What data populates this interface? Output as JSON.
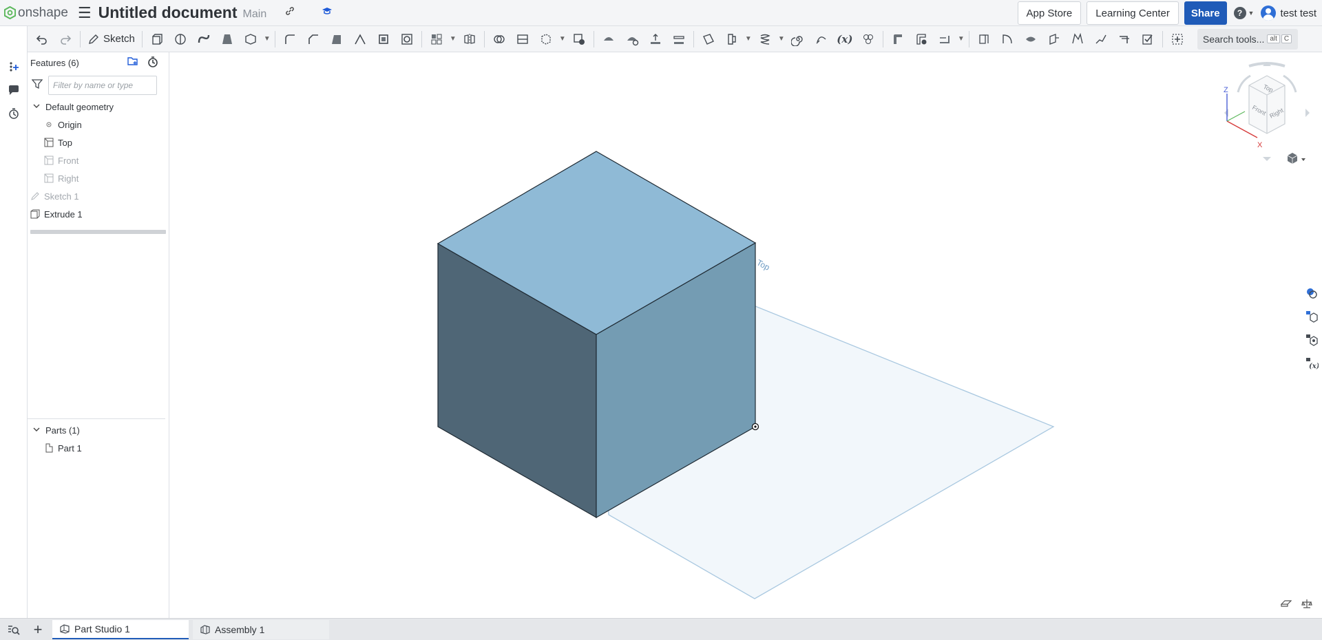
{
  "app": {
    "logo_text": "onshape",
    "document_title": "Untitled document",
    "branch": "Main"
  },
  "topbar": {
    "app_store_label": "App Store",
    "learning_center_label": "Learning Center",
    "share_label": "Share",
    "help_label": "?",
    "username": "test test"
  },
  "toolbar": {
    "sketch_label": "Sketch",
    "search_label": "Search tools...",
    "search_shortcut_alt": "alt",
    "search_shortcut_key": "C"
  },
  "features_panel": {
    "title": "Features (6)",
    "filter_placeholder": "Filter by name or type",
    "default_geometry_label": "Default geometry",
    "items": [
      {
        "label": "Origin"
      },
      {
        "label": "Top"
      },
      {
        "label": "Front"
      },
      {
        "label": "Right"
      },
      {
        "label": "Sketch 1"
      },
      {
        "label": "Extrude 1"
      }
    ],
    "parts_title": "Parts (1)",
    "parts": [
      {
        "label": "Part 1"
      }
    ]
  },
  "viewport": {
    "plane_label": "Top",
    "viewcube": {
      "top": "Top",
      "front": "Front",
      "right": "Right",
      "axis_x": "X",
      "axis_z": "Z"
    }
  },
  "tabs": [
    {
      "label": "Part Studio 1",
      "active": true
    },
    {
      "label": "Assembly 1",
      "active": false
    }
  ],
  "colors": {
    "accent": "#1f5bb8",
    "cube_top": "#8fbad6",
    "cube_left": "#4f6676",
    "cube_right": "#749cb3",
    "plane_fill": "#f2f7fb",
    "plane_edge": "#a9c8e0"
  }
}
